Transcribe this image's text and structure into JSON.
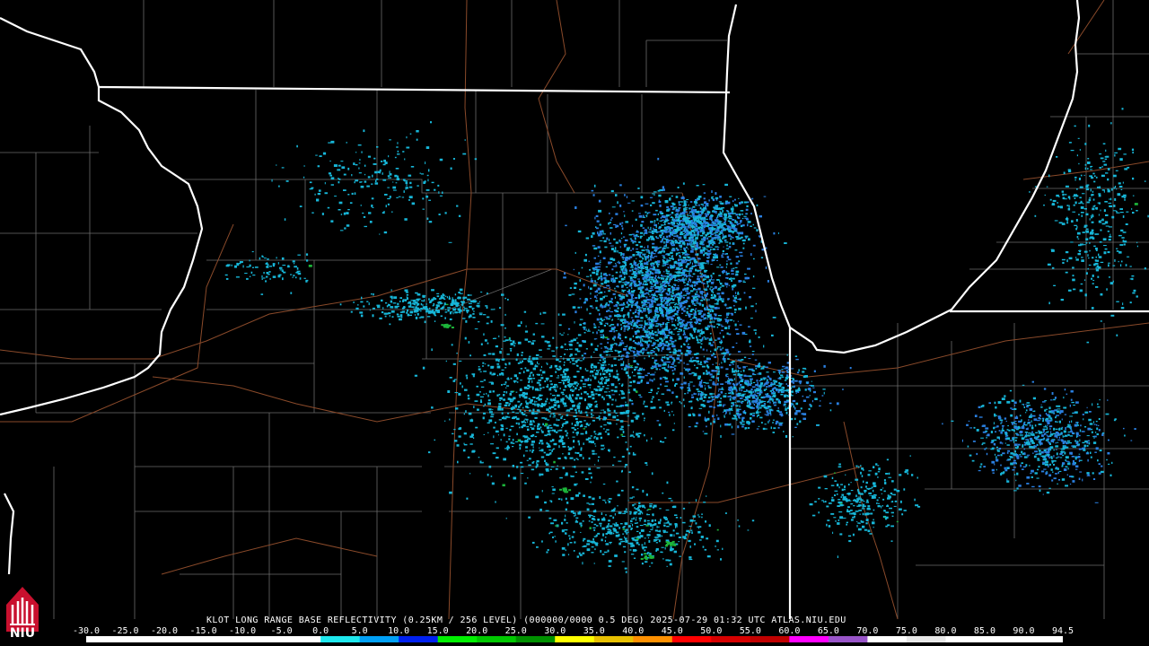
{
  "footer": {
    "product_text": "KLOT LONG RANGE BASE REFLECTIVITY (0.25KM / 256 LEVEL) (000000/0000 0.5 DEG) 2025-07-29 01:32 UTC  ATLAS.NIU.EDU"
  },
  "scale": {
    "labels": [
      "-30.0",
      "-25.0",
      "-20.0",
      "-15.0",
      "-10.0",
      "-5.0",
      "0.0",
      "5.0",
      "10.0",
      "15.0",
      "20.0",
      "25.0",
      "30.0",
      "35.0",
      "40.0",
      "45.0",
      "50.0",
      "55.0",
      "60.0",
      "65.0",
      "70.0",
      "75.0",
      "80.0",
      "85.0",
      "90.0",
      "94.5"
    ],
    "colors": [
      "#ffffff",
      "#ffffff",
      "#ffffff",
      "#ffffff",
      "#ffffff",
      "#ffffff",
      "#1ee8ee",
      "#00a0f6",
      "#0020f0",
      "#00f000",
      "#00c800",
      "#009000",
      "#ffff00",
      "#e8c000",
      "#ff9000",
      "#ff0000",
      "#d60000",
      "#c00000",
      "#ff00ff",
      "#9955c9",
      "#ffffff",
      "#e8e8e8",
      "#ffffff",
      "#ffffff",
      "#ffffff"
    ]
  },
  "logo": {
    "text": "NIU",
    "name": "niu-logo"
  },
  "colors": {
    "background": "#000000",
    "state_lines": "#ffffff",
    "county_lines": "#6b6b6b",
    "roads": "#8a4a2a",
    "echo_light": "#17b6d8",
    "echo_mid": "#2a7fe0",
    "echo_green": "#1db53a"
  }
}
